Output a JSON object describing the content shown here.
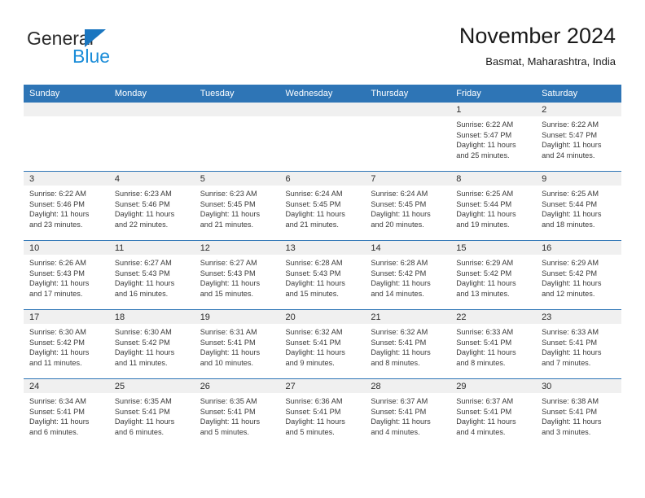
{
  "brand": {
    "name_top": "General",
    "name_bottom": "Blue",
    "triangle_color": "#1a76c0",
    "blue_text_color": "#1a8cd8"
  },
  "header": {
    "title": "November 2024",
    "subtitle": "Basmat, Maharashtra, India"
  },
  "theme": {
    "header_bg": "#2e75b6",
    "daynum_band_bg": "#f0f0f0",
    "cell_bg": "#ffffff",
    "row_border": "#2e75b6",
    "text": "#3a3a3a"
  },
  "weekdays": [
    "Sunday",
    "Monday",
    "Tuesday",
    "Wednesday",
    "Thursday",
    "Friday",
    "Saturday"
  ],
  "weeks": [
    [
      {
        "day": "",
        "lines": []
      },
      {
        "day": "",
        "lines": []
      },
      {
        "day": "",
        "lines": []
      },
      {
        "day": "",
        "lines": []
      },
      {
        "day": "",
        "lines": []
      },
      {
        "day": "1",
        "lines": [
          "Sunrise: 6:22 AM",
          "Sunset: 5:47 PM",
          "Daylight: 11 hours",
          "and 25 minutes."
        ]
      },
      {
        "day": "2",
        "lines": [
          "Sunrise: 6:22 AM",
          "Sunset: 5:47 PM",
          "Daylight: 11 hours",
          "and 24 minutes."
        ]
      }
    ],
    [
      {
        "day": "3",
        "lines": [
          "Sunrise: 6:22 AM",
          "Sunset: 5:46 PM",
          "Daylight: 11 hours",
          "and 23 minutes."
        ]
      },
      {
        "day": "4",
        "lines": [
          "Sunrise: 6:23 AM",
          "Sunset: 5:46 PM",
          "Daylight: 11 hours",
          "and 22 minutes."
        ]
      },
      {
        "day": "5",
        "lines": [
          "Sunrise: 6:23 AM",
          "Sunset: 5:45 PM",
          "Daylight: 11 hours",
          "and 21 minutes."
        ]
      },
      {
        "day": "6",
        "lines": [
          "Sunrise: 6:24 AM",
          "Sunset: 5:45 PM",
          "Daylight: 11 hours",
          "and 21 minutes."
        ]
      },
      {
        "day": "7",
        "lines": [
          "Sunrise: 6:24 AM",
          "Sunset: 5:45 PM",
          "Daylight: 11 hours",
          "and 20 minutes."
        ]
      },
      {
        "day": "8",
        "lines": [
          "Sunrise: 6:25 AM",
          "Sunset: 5:44 PM",
          "Daylight: 11 hours",
          "and 19 minutes."
        ]
      },
      {
        "day": "9",
        "lines": [
          "Sunrise: 6:25 AM",
          "Sunset: 5:44 PM",
          "Daylight: 11 hours",
          "and 18 minutes."
        ]
      }
    ],
    [
      {
        "day": "10",
        "lines": [
          "Sunrise: 6:26 AM",
          "Sunset: 5:43 PM",
          "Daylight: 11 hours",
          "and 17 minutes."
        ]
      },
      {
        "day": "11",
        "lines": [
          "Sunrise: 6:27 AM",
          "Sunset: 5:43 PM",
          "Daylight: 11 hours",
          "and 16 minutes."
        ]
      },
      {
        "day": "12",
        "lines": [
          "Sunrise: 6:27 AM",
          "Sunset: 5:43 PM",
          "Daylight: 11 hours",
          "and 15 minutes."
        ]
      },
      {
        "day": "13",
        "lines": [
          "Sunrise: 6:28 AM",
          "Sunset: 5:43 PM",
          "Daylight: 11 hours",
          "and 15 minutes."
        ]
      },
      {
        "day": "14",
        "lines": [
          "Sunrise: 6:28 AM",
          "Sunset: 5:42 PM",
          "Daylight: 11 hours",
          "and 14 minutes."
        ]
      },
      {
        "day": "15",
        "lines": [
          "Sunrise: 6:29 AM",
          "Sunset: 5:42 PM",
          "Daylight: 11 hours",
          "and 13 minutes."
        ]
      },
      {
        "day": "16",
        "lines": [
          "Sunrise: 6:29 AM",
          "Sunset: 5:42 PM",
          "Daylight: 11 hours",
          "and 12 minutes."
        ]
      }
    ],
    [
      {
        "day": "17",
        "lines": [
          "Sunrise: 6:30 AM",
          "Sunset: 5:42 PM",
          "Daylight: 11 hours",
          "and 11 minutes."
        ]
      },
      {
        "day": "18",
        "lines": [
          "Sunrise: 6:30 AM",
          "Sunset: 5:42 PM",
          "Daylight: 11 hours",
          "and 11 minutes."
        ]
      },
      {
        "day": "19",
        "lines": [
          "Sunrise: 6:31 AM",
          "Sunset: 5:41 PM",
          "Daylight: 11 hours",
          "and 10 minutes."
        ]
      },
      {
        "day": "20",
        "lines": [
          "Sunrise: 6:32 AM",
          "Sunset: 5:41 PM",
          "Daylight: 11 hours",
          "and 9 minutes."
        ]
      },
      {
        "day": "21",
        "lines": [
          "Sunrise: 6:32 AM",
          "Sunset: 5:41 PM",
          "Daylight: 11 hours",
          "and 8 minutes."
        ]
      },
      {
        "day": "22",
        "lines": [
          "Sunrise: 6:33 AM",
          "Sunset: 5:41 PM",
          "Daylight: 11 hours",
          "and 8 minutes."
        ]
      },
      {
        "day": "23",
        "lines": [
          "Sunrise: 6:33 AM",
          "Sunset: 5:41 PM",
          "Daylight: 11 hours",
          "and 7 minutes."
        ]
      }
    ],
    [
      {
        "day": "24",
        "lines": [
          "Sunrise: 6:34 AM",
          "Sunset: 5:41 PM",
          "Daylight: 11 hours",
          "and 6 minutes."
        ]
      },
      {
        "day": "25",
        "lines": [
          "Sunrise: 6:35 AM",
          "Sunset: 5:41 PM",
          "Daylight: 11 hours",
          "and 6 minutes."
        ]
      },
      {
        "day": "26",
        "lines": [
          "Sunrise: 6:35 AM",
          "Sunset: 5:41 PM",
          "Daylight: 11 hours",
          "and 5 minutes."
        ]
      },
      {
        "day": "27",
        "lines": [
          "Sunrise: 6:36 AM",
          "Sunset: 5:41 PM",
          "Daylight: 11 hours",
          "and 5 minutes."
        ]
      },
      {
        "day": "28",
        "lines": [
          "Sunrise: 6:37 AM",
          "Sunset: 5:41 PM",
          "Daylight: 11 hours",
          "and 4 minutes."
        ]
      },
      {
        "day": "29",
        "lines": [
          "Sunrise: 6:37 AM",
          "Sunset: 5:41 PM",
          "Daylight: 11 hours",
          "and 4 minutes."
        ]
      },
      {
        "day": "30",
        "lines": [
          "Sunrise: 6:38 AM",
          "Sunset: 5:41 PM",
          "Daylight: 11 hours",
          "and 3 minutes."
        ]
      }
    ]
  ]
}
